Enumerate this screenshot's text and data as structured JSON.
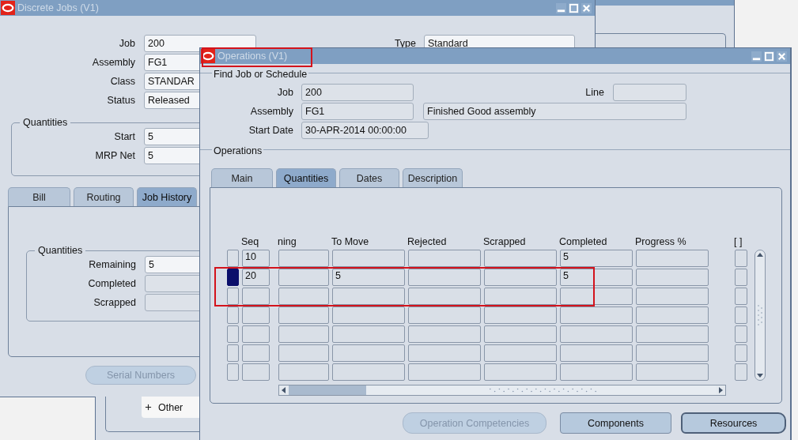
{
  "discrete_jobs": {
    "title": "Discrete Jobs (V1)",
    "fields": [
      {
        "label": "Job",
        "value": "200"
      },
      {
        "label": "Assembly",
        "value": "FG1"
      },
      {
        "label": "Class",
        "value": "STANDAR"
      },
      {
        "label": "Status",
        "value": "Released"
      }
    ],
    "type": {
      "label": "Type",
      "value": "Standard"
    },
    "quantities": {
      "title": "Quantities",
      "fields": [
        {
          "label": "Start",
          "value": "5"
        },
        {
          "label": "MRP Net",
          "value": "5"
        }
      ]
    },
    "tabs": [
      {
        "label": "Bill",
        "selected": false
      },
      {
        "label": "Routing",
        "selected": false
      },
      {
        "label": "Job History",
        "selected": true
      }
    ],
    "history_quantities": {
      "title": "Quantities",
      "fields": [
        {
          "label": "Remaining",
          "value": "5"
        },
        {
          "label": "Completed"
        },
        {
          "label": "Scrapped"
        }
      ]
    },
    "serial_button": {
      "label": "Serial Numbers",
      "disabled": true
    }
  },
  "tree": {
    "items": [
      {
        "label": "Other",
        "expanded": false
      }
    ]
  },
  "operations": {
    "title": "Operations (V1)",
    "find_group": "Find Job or Schedule",
    "job": {
      "label": "Job",
      "value": "200"
    },
    "line": {
      "label": "Line"
    },
    "assembly": {
      "label": "Assembly",
      "value": "FG1",
      "description": "Finished Good assembly"
    },
    "start_date": {
      "label": "Start Date",
      "value": "30-APR-2014 00:00:00"
    },
    "group_title": "Operations",
    "tabs": [
      {
        "label": "Main",
        "selected": false
      },
      {
        "label": "Quantities",
        "selected": true
      },
      {
        "label": "Dates",
        "selected": false
      },
      {
        "label": "Description",
        "selected": false
      }
    ],
    "columns": [
      "Seq",
      "ning",
      "To Move",
      "Rejected",
      "Scrapped",
      "Completed",
      "Progress %"
    ],
    "check_column": "[ ]",
    "rows": [
      {
        "selected": false,
        "checked": false,
        "cells": [
          "10",
          null,
          null,
          null,
          null,
          "5",
          null
        ]
      },
      {
        "selected": true,
        "checked": false,
        "cells": [
          "20",
          null,
          "5",
          null,
          null,
          "5",
          null
        ]
      },
      {
        "selected": false,
        "checked": false
      },
      {
        "selected": false,
        "checked": false
      },
      {
        "selected": false,
        "checked": false
      },
      {
        "selected": false,
        "checked": false
      },
      {
        "selected": false,
        "checked": false
      }
    ],
    "buttons": [
      {
        "label": "Operation Competencies",
        "disabled": true
      },
      {
        "label": "Components",
        "disabled": false
      },
      {
        "label": "Resources",
        "disabled": false
      }
    ]
  }
}
